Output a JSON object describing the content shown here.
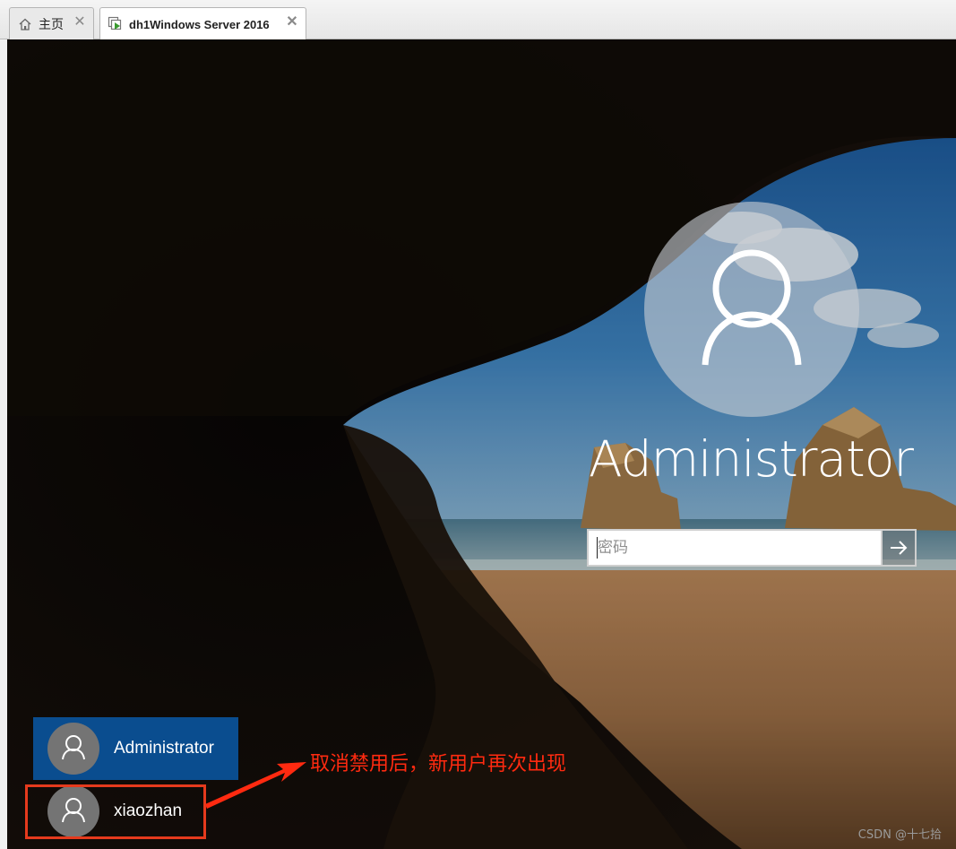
{
  "tabs": [
    {
      "label": "主页",
      "icon": "home-icon",
      "active": false
    },
    {
      "label": "dh1Windows Server 2016",
      "icon": "vm-running-icon",
      "active": true
    }
  ],
  "tab_close_glyph": "✕",
  "login": {
    "username": "Administrator",
    "password_placeholder": "密码",
    "submit_icon": "arrow-right-icon"
  },
  "user_list": [
    {
      "name": "Administrator",
      "selected": true
    },
    {
      "name": "xiaozhan",
      "selected": false
    }
  ],
  "annotation": {
    "text": "取消禁用后，新用户再次出现",
    "color": "#e53a1d"
  },
  "watermark": "CSDN @十七拾",
  "colors": {
    "selected_tile": "#0a4d8f",
    "vm_icon": "#3a9a2f"
  }
}
